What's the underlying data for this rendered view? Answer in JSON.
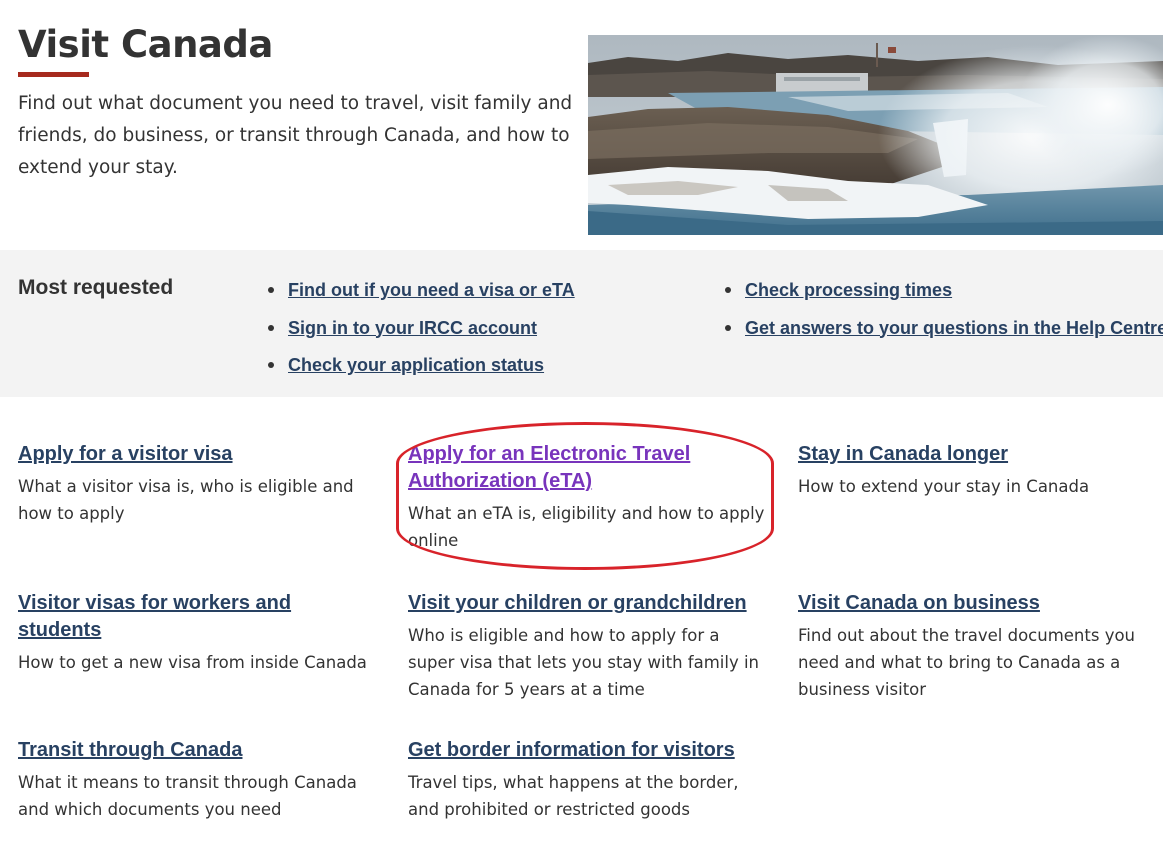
{
  "header": {
    "title": "Visit Canada",
    "intro": "Find out what document you need to travel, visit family and friends, do business, or transit through Canada, and how to extend your stay."
  },
  "most_requested": {
    "heading": "Most requested",
    "column1": [
      {
        "label": "Find out if you need a visa or eTA"
      },
      {
        "label": "Sign in to your IRCC account"
      },
      {
        "label": "Check your application status"
      }
    ],
    "column2": [
      {
        "label": "Check processing times"
      },
      {
        "label": "Get answers to your questions in the Help Centre"
      }
    ]
  },
  "cards": [
    {
      "title": "Apply for a visitor visa",
      "description": "What a visitor visa is, who is eligible and how to apply"
    },
    {
      "title": "Apply for an Electronic Travel Authorization (eTA)",
      "description": "What an eTA is, eligibility and how to apply online"
    },
    {
      "title": "Stay in Canada longer",
      "description": "How to extend your stay in Canada"
    },
    {
      "title": "Visitor visas for workers and students",
      "description": "How to get a new visa from inside Canada"
    },
    {
      "title": "Visit your children or grandchildren",
      "description": "Who is eligible and how to apply for a super visa that lets you stay with family in Canada for 5 years at a time"
    },
    {
      "title": "Visit Canada on business",
      "description": "Find out about the travel documents you need and what to bring to Canada as a business visitor"
    },
    {
      "title": "Transit through Canada",
      "description": "What it means to transit through Canada and which documents you need"
    },
    {
      "title": "Get border information for visitors",
      "description": "Travel tips, what happens at the border, and prohibited or restricted goods"
    }
  ],
  "colors": {
    "link": "#284162",
    "visited_link": "#7834bc",
    "accent_underline": "#a62a1e",
    "highlight": "#d8232a",
    "band_background": "#f3f3f3"
  }
}
